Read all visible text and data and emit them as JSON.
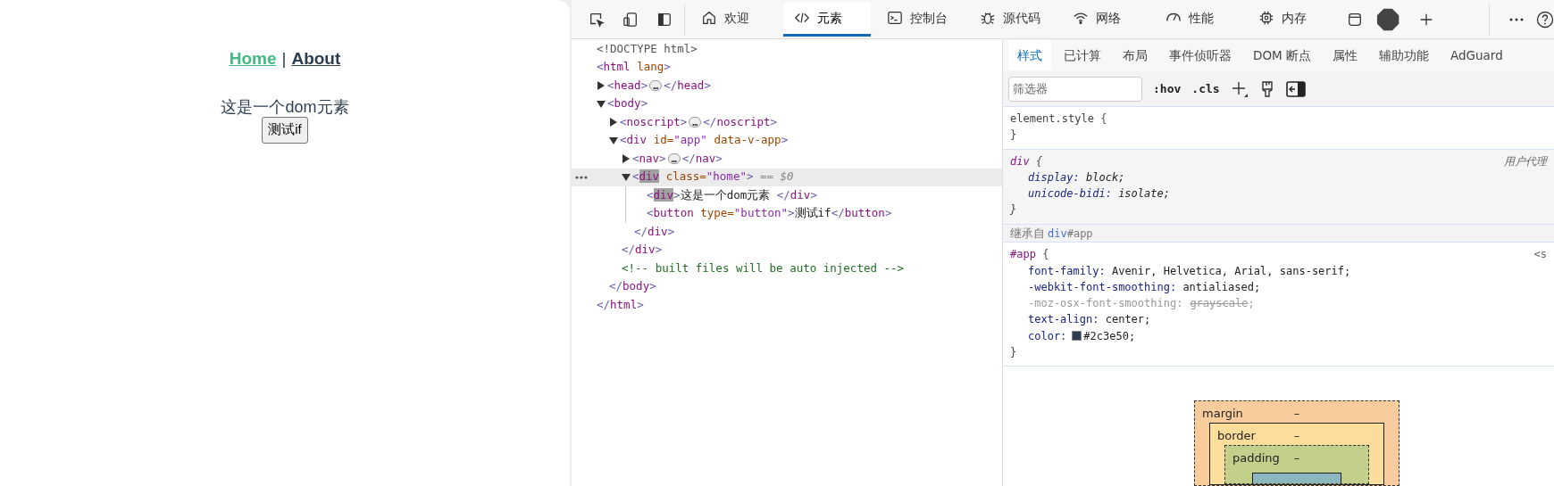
{
  "page": {
    "nav": [
      {
        "label": "Home",
        "selected": true
      },
      {
        "separator": "|"
      },
      {
        "label": "About",
        "selected": false
      }
    ],
    "text": "这是一个dom元素",
    "button": "测试if"
  },
  "toolbar": {
    "tabs": [
      {
        "label": "欢迎",
        "selected": false
      },
      {
        "label": "元素",
        "selected": true
      },
      {
        "label": "控制台",
        "selected": false
      },
      {
        "label": "源代码",
        "selected": false
      },
      {
        "label": "网络",
        "selected": false
      },
      {
        "label": "性能",
        "selected": false
      },
      {
        "label": "内存",
        "selected": false
      }
    ]
  },
  "tree": [
    {
      "tokens": [
        {
          "kind": "doctype",
          "text": "<!DOCTYPE html>"
        }
      ],
      "selected": false
    },
    {
      "tokens": [
        {
          "kind": "bracket",
          "text": "<"
        },
        {
          "kind": "tag",
          "text": "html"
        },
        {
          "kind": "attr",
          "text": " lang"
        },
        {
          "kind": "bracket",
          "text": ">"
        }
      ],
      "selected": false,
      "children": [
        {
          "expanded": false,
          "selected": false,
          "tokens": [
            {
              "kind": "bracket",
              "text": "<"
            },
            {
              "kind": "tag",
              "text": "head"
            },
            {
              "kind": "bracket",
              "text": ">"
            },
            {
              "kind": "ellipsis",
              "text": "…"
            },
            {
              "kind": "bracket",
              "text": "</"
            },
            {
              "kind": "tag",
              "text": "head"
            },
            {
              "kind": "bracket",
              "text": ">"
            }
          ]
        },
        {
          "expanded": true,
          "selected": false,
          "tokens": [
            {
              "kind": "bracket",
              "text": "<"
            },
            {
              "kind": "tag",
              "text": "body"
            },
            {
              "kind": "bracket",
              "text": ">"
            }
          ],
          "children": [
            {
              "expanded": false,
              "selected": false,
              "tokens": [
                {
                  "kind": "bracket",
                  "text": "<"
                },
                {
                  "kind": "tag",
                  "text": "noscript"
                },
                {
                  "kind": "bracket",
                  "text": ">"
                },
                {
                  "kind": "ellipsis",
                  "text": "…"
                },
                {
                  "kind": "bracket",
                  "text": "</"
                },
                {
                  "kind": "tag",
                  "text": "noscript"
                },
                {
                  "kind": "bracket",
                  "text": ">"
                }
              ]
            },
            {
              "expanded": true,
              "selected": false,
              "tokens": [
                {
                  "kind": "bracket",
                  "text": "<"
                },
                {
                  "kind": "tag",
                  "text": "div"
                },
                {
                  "kind": "attr",
                  "text": " id="
                },
                {
                  "kind": "value",
                  "text": "\"app\""
                },
                {
                  "kind": "attr",
                  "text": " data-v-app"
                },
                {
                  "kind": "bracket",
                  "text": ">"
                }
              ],
              "children": [
                {
                  "expanded": false,
                  "selected": false,
                  "tokens": [
                    {
                      "kind": "bracket",
                      "text": "<"
                    },
                    {
                      "kind": "tag",
                      "text": "nav"
                    },
                    {
                      "kind": "bracket",
                      "text": ">"
                    },
                    {
                      "kind": "ellipsis",
                      "text": "…"
                    },
                    {
                      "kind": "bracket",
                      "text": "</"
                    },
                    {
                      "kind": "tag",
                      "text": "nav"
                    },
                    {
                      "kind": "bracket",
                      "text": ">"
                    }
                  ]
                },
                {
                  "expanded": true,
                  "selected": true,
                  "tokens": [
                    {
                      "kind": "bracket",
                      "text": "<"
                    },
                    {
                      "kind": "match",
                      "text": "div"
                    },
                    {
                      "kind": "attr",
                      "text": " class="
                    },
                    {
                      "kind": "value",
                      "text": "\"home\""
                    },
                    {
                      "kind": "bracket",
                      "text": ">"
                    },
                    {
                      "kind": "ref",
                      "text": " == $0"
                    }
                  ],
                  "children": [
                    {
                      "selected": false,
                      "tokens": [
                        {
                          "kind": "bracket",
                          "text": "<"
                        },
                        {
                          "kind": "match",
                          "text": "div"
                        },
                        {
                          "kind": "bracket",
                          "text": ">"
                        },
                        {
                          "kind": "text",
                          "text": "这是一个dom元素 "
                        },
                        {
                          "kind": "bracket",
                          "text": "</"
                        },
                        {
                          "kind": "tag",
                          "text": "div"
                        },
                        {
                          "kind": "bracket",
                          "text": ">"
                        }
                      ]
                    },
                    {
                      "selected": false,
                      "tokens": [
                        {
                          "kind": "bracket",
                          "text": "<"
                        },
                        {
                          "kind": "tag",
                          "text": "button"
                        },
                        {
                          "kind": "attr",
                          "text": " type="
                        },
                        {
                          "kind": "value",
                          "text": "\"button\""
                        },
                        {
                          "kind": "bracket",
                          "text": ">"
                        },
                        {
                          "kind": "text",
                          "text": "测试if"
                        },
                        {
                          "kind": "bracket",
                          "text": "</"
                        },
                        {
                          "kind": "tag",
                          "text": "button"
                        },
                        {
                          "kind": "bracket",
                          "text": ">"
                        }
                      ]
                    }
                  ],
                  "closing": [
                    {
                      "kind": "bracket",
                      "text": "</"
                    },
                    {
                      "kind": "tag",
                      "text": "div"
                    },
                    {
                      "kind": "bracket",
                      "text": ">"
                    }
                  ]
                }
              ],
              "closing": [
                {
                  "kind": "bracket",
                  "text": "</"
                },
                {
                  "kind": "tag",
                  "text": "div"
                },
                {
                  "kind": "bracket",
                  "text": ">"
                }
              ]
            },
            {
              "selected": false,
              "tokens": [
                {
                  "kind": "comment",
                  "text": "<!-- built files will be auto injected -->"
                }
              ]
            }
          ],
          "closing": [
            {
              "kind": "bracket",
              "text": "</"
            },
            {
              "kind": "tag",
              "text": "body"
            },
            {
              "kind": "bracket",
              "text": ">"
            }
          ]
        }
      ],
      "closing": [
        {
          "kind": "bracket",
          "text": "</"
        },
        {
          "kind": "tag",
          "text": "html"
        },
        {
          "kind": "bracket",
          "text": ">"
        }
      ]
    }
  ],
  "styles": {
    "tabs": [
      {
        "label": "样式",
        "selected": true
      },
      {
        "label": "已计算",
        "selected": false
      },
      {
        "label": "布局",
        "selected": false
      },
      {
        "label": "事件侦听器",
        "selected": false
      },
      {
        "label": "DOM 断点",
        "selected": false
      },
      {
        "label": "属性",
        "selected": false
      },
      {
        "label": "辅助功能",
        "selected": false
      },
      {
        "label": "AdGuard",
        "selected": false
      }
    ],
    "filter": {
      "placeholder": "筛选器"
    },
    "hov": ":hov",
    "cls": ".cls",
    "sections": [
      {
        "kind": "element",
        "selector": "element.style",
        "open": " {",
        "close": "}"
      },
      {
        "kind": "ua",
        "selector": "div",
        "open": " {",
        "close": "}",
        "origin": "用户代理",
        "properties": [
          {
            "name": "display:",
            "value": " block",
            "end": ";",
            "overridden": false
          },
          {
            "name": "unicode-bidi:",
            "value": " isolate",
            "end": ";",
            "overridden": false
          }
        ]
      },
      {
        "kind": "inherited",
        "label": "继承自",
        "link": "div",
        "rest": "#app"
      },
      {
        "kind": "author",
        "selector": "#app",
        "open": " {",
        "close": "}",
        "origin": "<s",
        "properties": [
          {
            "name": "font-family:",
            "value": " Avenir, Helvetica, Arial, sans-serif",
            "end": ";",
            "overridden": false
          },
          {
            "name": "-webkit-font-smoothing:",
            "value": " antialiased",
            "end": ";",
            "overridden": false
          },
          {
            "name": "-moz-osx-font-smoothing:",
            "value": "grayscale",
            "end": ";",
            "overridden": true
          },
          {
            "name": "text-align:",
            "value": " center",
            "end": ";",
            "overridden": false
          },
          {
            "name": "color:",
            "value": "#2c3e50",
            "end": ";",
            "overridden": false,
            "kind": "color"
          }
        ]
      }
    ]
  },
  "box_model": {
    "layers": [
      {
        "label": "margin",
        "value": "–"
      },
      {
        "label": "border",
        "value": "–"
      },
      {
        "label": "padding",
        "value": "–"
      }
    ]
  }
}
